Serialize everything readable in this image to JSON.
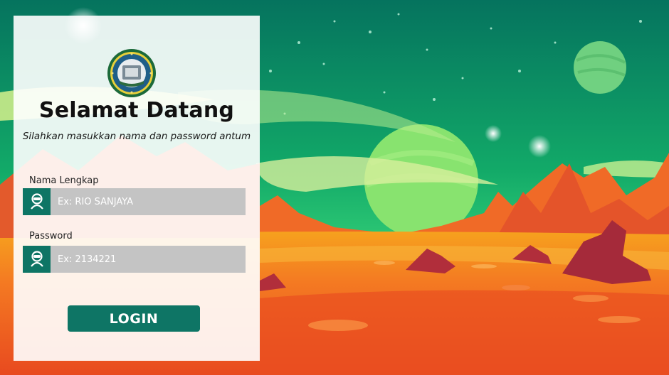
{
  "login": {
    "title": "Selamat Datang",
    "subtitle": "Silahkan masukkan nama dan password antum",
    "name_label": "Nama Lengkap",
    "name_placeholder": "Ex: RIO SANJAYA",
    "password_label": "Password",
    "password_placeholder": "Ex: 2134221",
    "button_label": "LOGIN"
  },
  "icons": {
    "name_field": "user-icon",
    "password_field": "user-icon",
    "logo": "emblem-logo"
  },
  "colors": {
    "accent": "#0e7565",
    "input_bg": "#c4c4c4",
    "sky_top": "#06765f",
    "sky_mid": "#19c26a",
    "ground": "#ef5a22"
  }
}
